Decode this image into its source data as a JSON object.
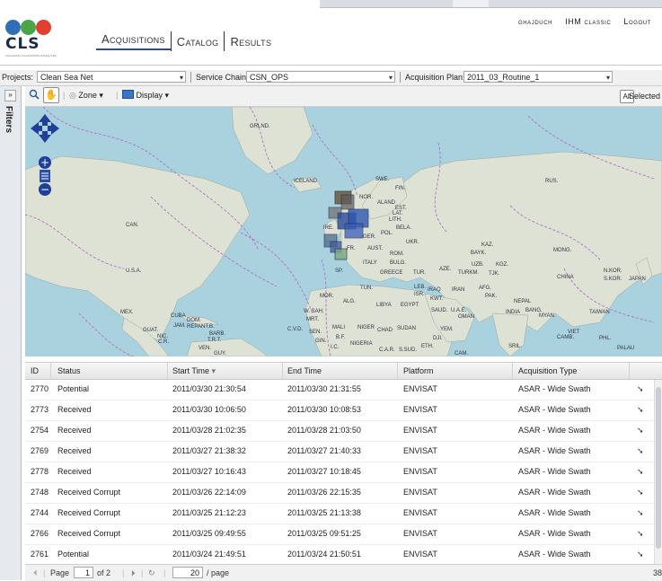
{
  "header": {
    "logo_text": "CLS",
    "logo_tagline": "COLLECTE LOCALISATION SATELLITES",
    "logo_colors": [
      "#2e6fb5",
      "#49a548",
      "#e0412f"
    ],
    "tabs": [
      {
        "label": "Acquisitions",
        "active": true
      },
      {
        "label": "Catalog",
        "active": false
      },
      {
        "label": "Results",
        "active": false
      }
    ],
    "user": "ghajduch",
    "ihm_classic": "IHM classic",
    "logout": "Logout"
  },
  "projbar": {
    "projects_label": "Projects:",
    "projects_value": "Clean Sea Net",
    "service_chain_label": "Service Chain:",
    "service_chain_value": "CSN_OPS",
    "acq_plan_label": "Acquisition Plan:",
    "acq_plan_value": "2011_03_Routine_1"
  },
  "filters": {
    "toggle": "»",
    "label": "Filters"
  },
  "maptools": {
    "zone_label": "Zone",
    "display_label": "Display",
    "all_label": "All",
    "selected_label": "Selected"
  },
  "map": {
    "labels": [
      "GRLND.",
      "ICELAND",
      "SWE.",
      "FIN.",
      "NOR.",
      "ALAND",
      "EST.",
      "LAT.",
      "LITH.",
      "BELA.",
      "IRE.",
      "GER.",
      "POL.",
      "UKR.",
      "FR.",
      "AUST.",
      "ROM.",
      "BULG.",
      "ITALY",
      "GREECE",
      "TUR.",
      "AZE.",
      "KAZ.",
      "BAYK.",
      "UZB.",
      "KGZ.",
      "TURKM.",
      "TJK.",
      "RUS.",
      "MONG.",
      "CHINA",
      "N.KOR.",
      "S.KOR.",
      "JAPAN",
      "CAN.",
      "U.S.A.",
      "SP.",
      "TUN.",
      "LEB.",
      "ISR.",
      "IRAQ",
      "KWT.",
      "IRAN",
      "AFG.",
      "PAK.",
      "NEPAL",
      "INDIA",
      "BANG.",
      "MYAN.",
      "TAIWAN",
      "MOR.",
      "ALG.",
      "LIBYA",
      "EGYPT",
      "SAUD.",
      "U.A.E.",
      "OMAN",
      "YEM.",
      "W. SAH.",
      "MRT.",
      "MALI",
      "NIGER",
      "CHAD",
      "SUDAN",
      "SEN.",
      "GIN.",
      "B.F.",
      "NIGERIA",
      "I.C.",
      "C.A.R.",
      "S.SUD.",
      "ETH.",
      "DJI.",
      "C.V.D.",
      "MEX.",
      "CUBA",
      "DOM.",
      "JAM.",
      "REP.",
      "ANT.B.",
      "BARB.",
      "T.R.T.",
      "GUAT.",
      "NIC.",
      "C.R.",
      "VEN.",
      "GUY.",
      "CAM.",
      "SRIL.",
      "VIET",
      "CAMB.",
      "PHL.",
      "PALAU"
    ]
  },
  "grid": {
    "columns": [
      "ID",
      "Status",
      "Start Time",
      "End Time",
      "Platform",
      "Acquisition Type"
    ],
    "sort_indicator": "▾",
    "rows": [
      [
        "2770",
        "Potential",
        "2011/03/30 21:30:54",
        "2011/03/30 21:31:55",
        "ENVISAT",
        "ASAR - Wide Swath"
      ],
      [
        "2773",
        "Received",
        "2011/03/30 10:06:50",
        "2011/03/30 10:08:53",
        "ENVISAT",
        "ASAR - Wide Swath"
      ],
      [
        "2754",
        "Received",
        "2011/03/28 21:02:35",
        "2011/03/28 21:03:50",
        "ENVISAT",
        "ASAR - Wide Swath"
      ],
      [
        "2769",
        "Received",
        "2011/03/27 21:38:32",
        "2011/03/27 21:40:33",
        "ENVISAT",
        "ASAR - Wide Swath"
      ],
      [
        "2778",
        "Received",
        "2011/03/27 10:16:43",
        "2011/03/27 10:18:45",
        "ENVISAT",
        "ASAR - Wide Swath"
      ],
      [
        "2748",
        "Received Corrupt",
        "2011/03/26 22:14:09",
        "2011/03/26 22:15:35",
        "ENVISAT",
        "ASAR - Wide Swath"
      ],
      [
        "2744",
        "Received Corrupt",
        "2011/03/25 21:12:23",
        "2011/03/25 21:13:38",
        "ENVISAT",
        "ASAR - Wide Swath"
      ],
      [
        "2766",
        "Received Corrupt",
        "2011/03/25 09:49:55",
        "2011/03/25 09:51:25",
        "ENVISAT",
        "ASAR - Wide Swath"
      ],
      [
        "2761",
        "Potential",
        "2011/03/24 21:49:51",
        "2011/03/24 21:50:51",
        "ENVISAT",
        "ASAR - Wide Swath"
      ]
    ]
  },
  "pager": {
    "page_label": "Page",
    "page_value": "1",
    "of_label": "of 2",
    "page_size": "20",
    "per_page_label": "/ page",
    "right_count": "38"
  }
}
